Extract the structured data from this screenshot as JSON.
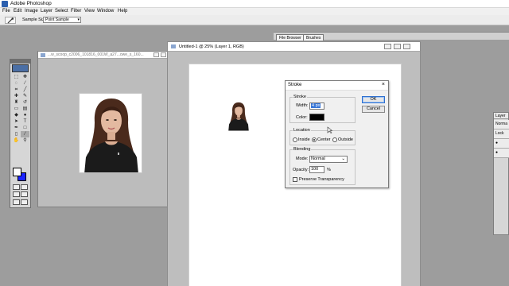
{
  "app": {
    "title": "Adobe Photoshop"
  },
  "menu": [
    "File",
    "Edit",
    "Image",
    "Layer",
    "Select",
    "Filter",
    "View",
    "Window",
    "Help"
  ],
  "options_bar": {
    "sample_size_label": "Sample Size:",
    "sample_size_value": "Point Sample"
  },
  "palette_well": {
    "tabs": [
      "File Browser",
      "Brushes"
    ]
  },
  "doc1": {
    "title": "...w_scoop_c2006_101816_001W_a27...owe_s_160..."
  },
  "doc2": {
    "title": "Untitled-1 @ 25% (Layer 1, RGB)"
  },
  "stroke_dialog": {
    "title": "Stroke",
    "close": "×",
    "stroke_group": "Stroke",
    "width_label": "Width:",
    "width_value": "4 px",
    "color_label": "Color:",
    "location_group": "Location",
    "locations": [
      "Inside",
      "Center",
      "Outside"
    ],
    "selected_location": "Center",
    "blending_group": "Blending",
    "mode_label": "Mode:",
    "mode_value": "Normal",
    "opacity_label": "Opacity:",
    "opacity_value": "100",
    "opacity_unit": "%",
    "preserve_label": "Preserve Transparency",
    "preserve_checked": false,
    "ok": "OK",
    "cancel": "Cancel",
    "stroke_color": "#000000"
  },
  "layers_panel": {
    "title": "Layer",
    "rows": [
      "Norma",
      "Lock",
      "",
      ""
    ]
  },
  "colors": {
    "foreground": "#ffffff",
    "background": "#1a22ff",
    "selection": "#3a78d8"
  }
}
